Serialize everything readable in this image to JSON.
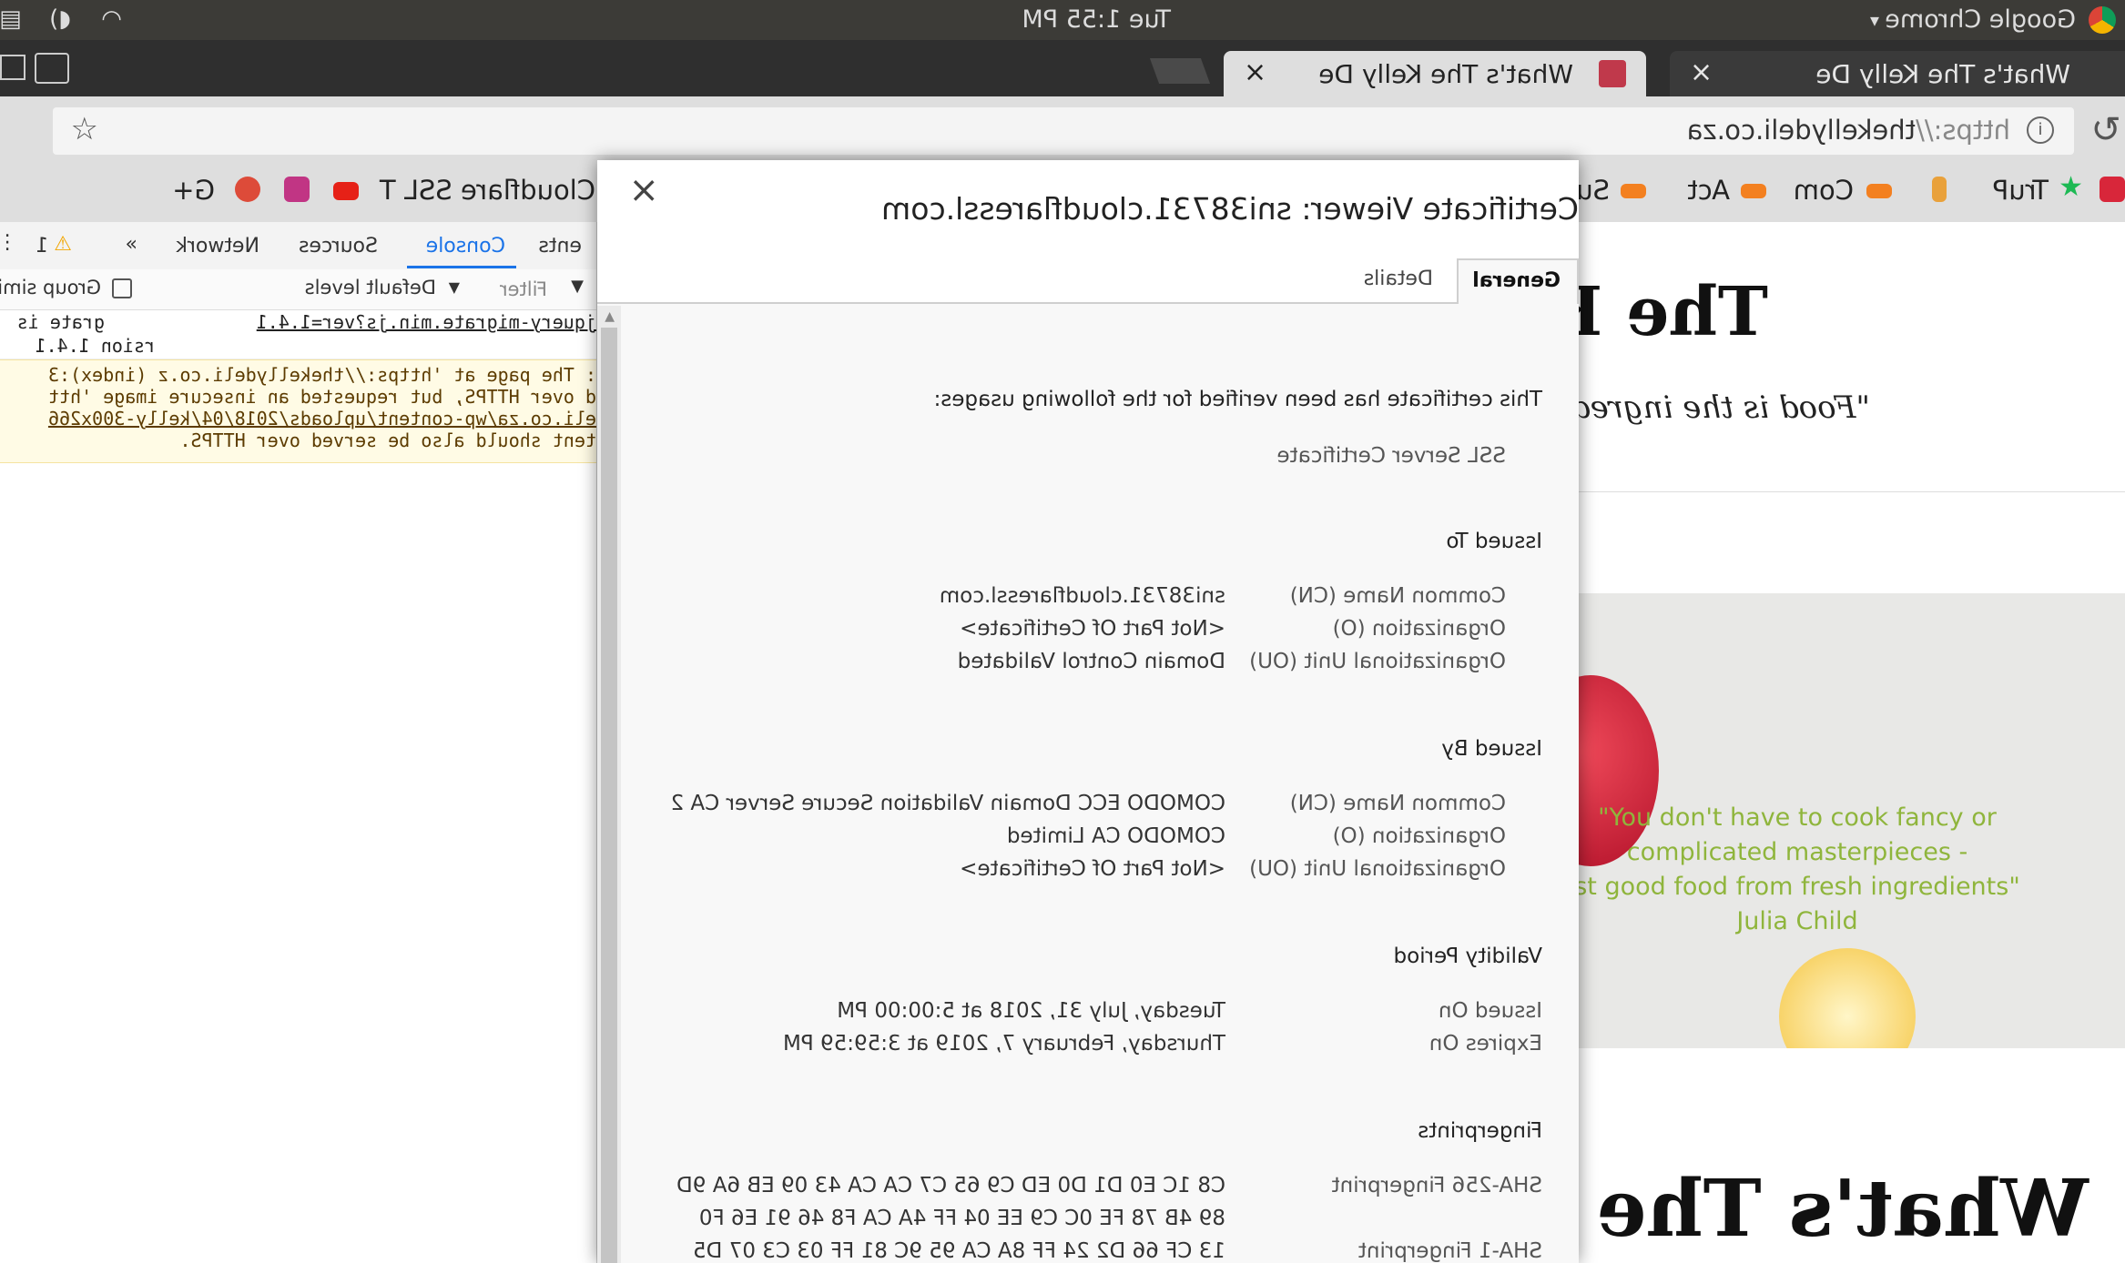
{
  "system_bar": {
    "clock": "Tue 1:55 PM",
    "app_name": "Google Chrome"
  },
  "tabs": [
    {
      "label": "What's The Kelly De",
      "active": true
    },
    {
      "label": "What's The Kelly De",
      "active": false
    }
  ],
  "address_bar": {
    "url_scheme": "https://",
    "url_host": "thekellydeli.co.za"
  },
  "bookmarks": [
    "TruP",
    "Com",
    "Act",
    "Su",
    "Cloudflare SSL T",
    "G+"
  ],
  "page": {
    "heading_top": "The K",
    "tagline": "\"Food is the ingredie",
    "quote_lines": [
      "\"You don't have to cook fancy or",
      "complicated masterpieces -",
      "st good food from fresh ingredients\"",
      "Julia Child"
    ],
    "heading_bottom": "What's The K"
  },
  "devtools": {
    "tabs": [
      "ents",
      "Console",
      "Sources",
      "Network",
      "»"
    ],
    "warning_count": "1",
    "filter_placeholder": "Filter",
    "levels_label": "Default levels",
    "group_label": "Group simila",
    "log_lines": [
      {
        "left": "grate is",
        "right": "jquery-migrate.min.js?ver=1.4.1"
      },
      {
        "left": "rsion 1.4.1",
        "right": ""
      }
    ],
    "warning_lines": [
      ": The page at 'https://thekellydeli.co.z (index):3",
      "d over HTTPS, but requested an insecure image 'htt",
      "eli.co.za/wp-content/uploads/2018/04/kelly-300x266",
      "tent should also be served over HTTPS."
    ]
  },
  "certificate_viewer": {
    "title": "Certificate Viewer: sni38731.cloudflaressl.com",
    "close_label": "×",
    "tabs": [
      "General",
      "Details"
    ],
    "verified_text": "This certificate has been verified for the following usages:",
    "usage": "SSL Server Certificate",
    "issued_to": {
      "heading": "Issued To",
      "rows": [
        {
          "label": "Common Name (CN)",
          "value": "sni38731.cloudflaressl.com"
        },
        {
          "label": "Organization (O)",
          "value": "<Not Part Of Certificate>"
        },
        {
          "label": "Organizational Unit (OU)",
          "value": "Domain Control Validated"
        }
      ]
    },
    "issued_by": {
      "heading": "Issued By",
      "rows": [
        {
          "label": "Common Name (CN)",
          "value": "COMODO ECC Domain Validation Secure Server CA 2"
        },
        {
          "label": "Organization (O)",
          "value": "COMODO CA Limited"
        },
        {
          "label": "Organizational Unit (OU)",
          "value": "<Not Part Of Certificate>"
        }
      ]
    },
    "validity": {
      "heading": "Validity Period",
      "rows": [
        {
          "label": "Issued On",
          "value": "Tuesday, July 31, 2018 at 5:00:00 PM"
        },
        {
          "label": "Expires On",
          "value": "Thursday, February 7, 2019 at 3:59:59 PM"
        }
      ]
    },
    "fingerprints": {
      "heading": "Fingerprints",
      "sha256_label": "SHA-256 Fingerprint",
      "sha256_lines": [
        "C8 1C E0 D1 D0 ED C9 65 C7 CA CA 43 09 EB 6A 9D",
        "89 4B 78 FE 0C C9 EE 04 FF 4A CA F8 46 91 E6 F0"
      ],
      "sha1_label": "SHA-1 Fingerprint",
      "sha1_line": "13 CF 66 D2 24 FF 8A CA 95 9C 81 FF 03 C3 07 D5"
    }
  },
  "colors": {
    "quote_green": "#8fb53c",
    "topbar": "#3c3b37",
    "warning_bg": "#fffbe5"
  }
}
